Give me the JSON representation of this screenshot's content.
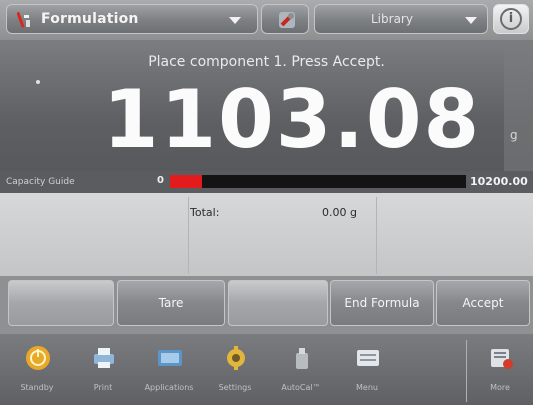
{
  "topbar": {
    "app_name": "Formulation",
    "app_icon": "formulation-icon",
    "tool_icon": "wrench-icon",
    "library_label": "Library",
    "info_icon": "info-icon",
    "info_glyph": "i"
  },
  "display": {
    "prompt": "Place component 1.  Press Accept.",
    "weight": "1103.08",
    "unit": "g"
  },
  "capacity": {
    "label": "Capacity Guide",
    "min": "0",
    "max": "10200.00",
    "fill_fraction": 0.108,
    "fill_color": "#e21c1c"
  },
  "info": {
    "total_label": "Total:",
    "total_value": "0.00 g"
  },
  "buttons": {
    "tare": "Tare",
    "end_formula": "End Formula",
    "accept": "Accept"
  },
  "nav": {
    "items": [
      {
        "label": "Standby",
        "icon": "standby-icon"
      },
      {
        "label": "Print",
        "icon": "print-icon"
      },
      {
        "label": "Applications",
        "icon": "applications-icon"
      },
      {
        "label": "Settings",
        "icon": "settings-icon"
      },
      {
        "label": "AutoCal™",
        "icon": "autocal-icon"
      },
      {
        "label": "Menu",
        "icon": "menu-icon"
      },
      {
        "label": "More",
        "icon": "more-icon"
      }
    ]
  }
}
